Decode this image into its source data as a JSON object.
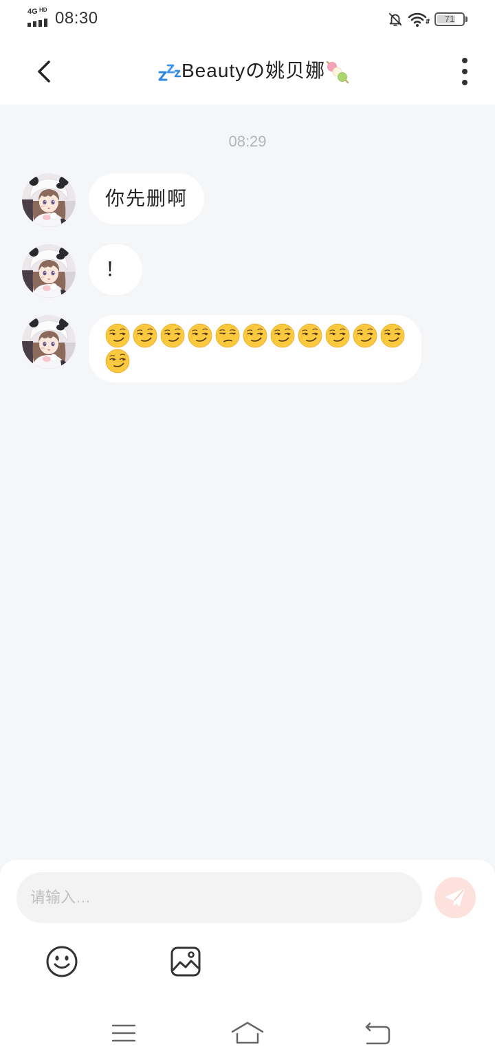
{
  "status_bar": {
    "network": "4G",
    "network_badge": "HD",
    "time": "08:30",
    "battery": "71",
    "icons": [
      "signal-icon",
      "bell-off-icon",
      "wifi-icon",
      "battery-icon"
    ]
  },
  "header": {
    "title": "Beautyの姚贝娜",
    "title_prefix_icon": "zzz-emoji-icon",
    "title_suffix_icon": "dango-emoji-icon",
    "back_icon": "back-chevron-icon",
    "menu_icon": "more-options-icon"
  },
  "chat": {
    "timestamp": "08:29",
    "messages": [
      {
        "text": "你先删啊"
      },
      {
        "text": "！"
      },
      {
        "emoji": [
          "smirking-face",
          "smirking-face",
          "smirking-face",
          "smirking-face",
          "unamused-face",
          "smirking-face",
          "smirking-face",
          "smirking-face",
          "smirking-face",
          "smirking-face",
          "smirking-face",
          "smirking-face"
        ]
      }
    ]
  },
  "composer": {
    "placeholder": "请输入…",
    "value": "",
    "send_icon": "paper-plane-icon",
    "tool_icons": [
      "smiley-icon",
      "image-icon"
    ]
  },
  "nav_bar": {
    "icons": [
      "menu-icon",
      "home-icon",
      "back-arrow-icon"
    ]
  },
  "colors": {
    "chat_background": "#f5f6f8",
    "bubble": "#ffffff",
    "send_button": "#fde1dc",
    "timestamp": "#b2b5ba",
    "text": "#222222"
  }
}
